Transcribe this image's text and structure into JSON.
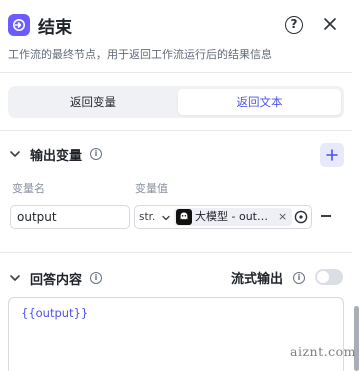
{
  "header": {
    "title": "结束",
    "description": "工作流的最终节点，用于返回工作流运行后的结果信息",
    "help_label": "?",
    "icon": "end-node-icon"
  },
  "tabs": [
    {
      "label": "返回变量",
      "active": false
    },
    {
      "label": "返回文本",
      "active": true
    }
  ],
  "output_vars": {
    "title": "输出变量",
    "col_name": "变量名",
    "col_value": "变量值",
    "row": {
      "name": "output",
      "type": "str.",
      "ref_text": "大模型 - out…",
      "ref_remove": "×"
    }
  },
  "answer": {
    "title": "回答内容",
    "stream_label": "流式输出",
    "stream_enabled": false,
    "content": "{{output}}"
  },
  "watermark": "aiznt.com",
  "colors": {
    "accent": "#4d53e8",
    "node_icon": "#6b5cff",
    "tab_bg": "#f0f1f5"
  }
}
